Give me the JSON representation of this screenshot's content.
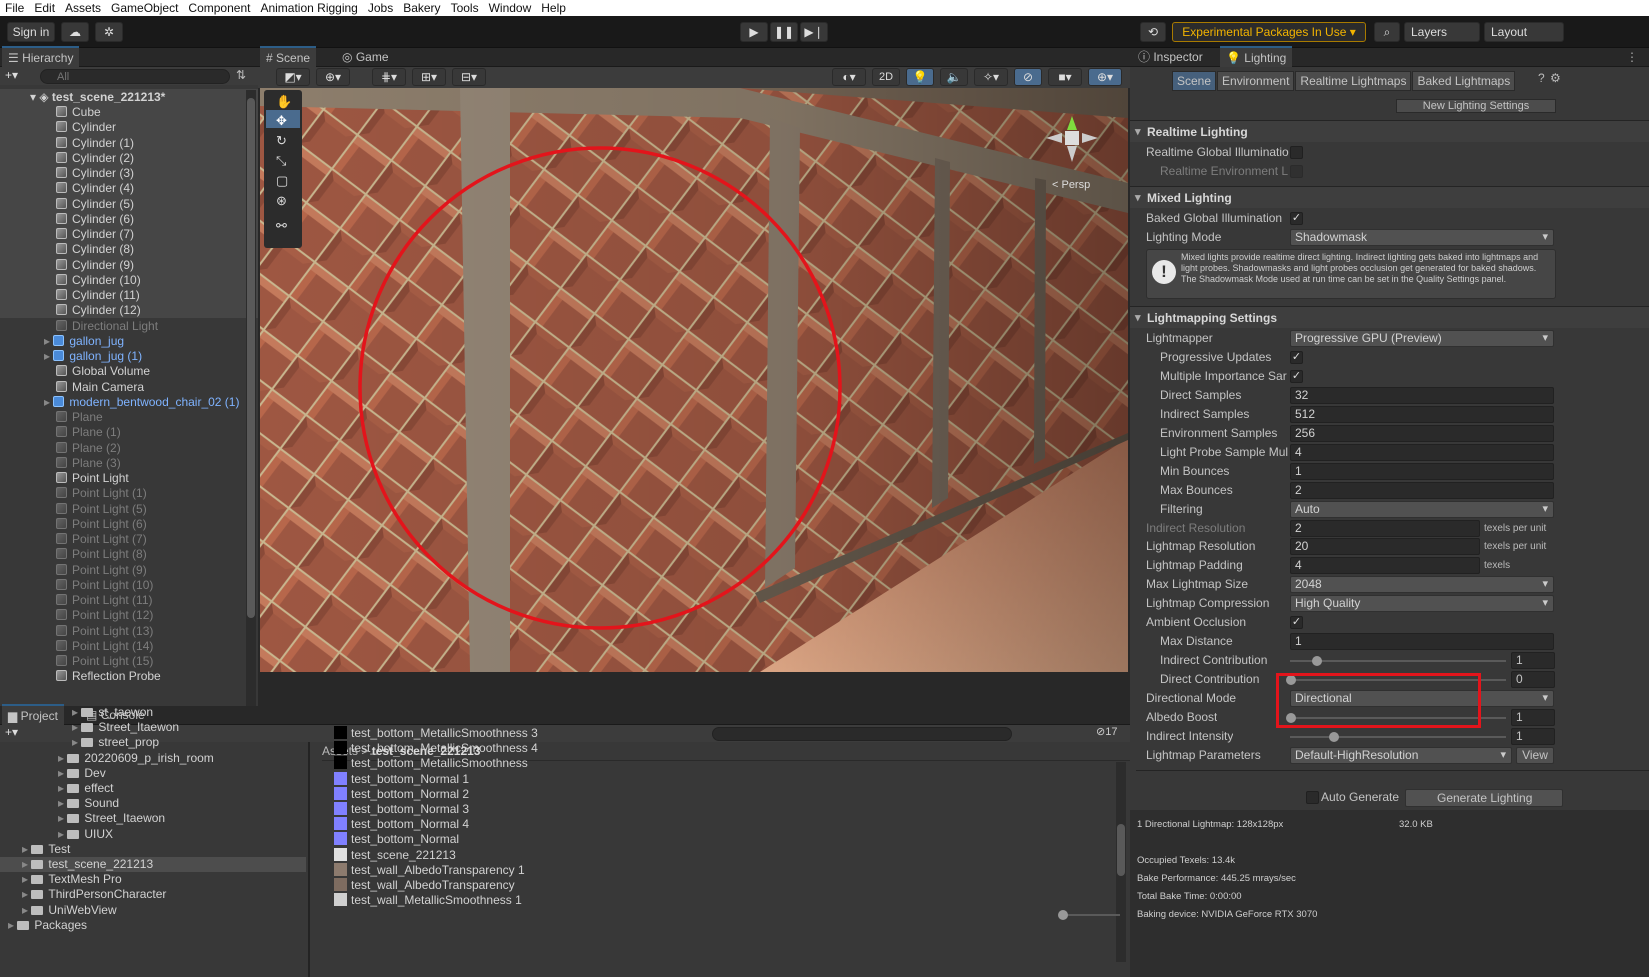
{
  "menu": [
    "File",
    "Edit",
    "Assets",
    "GameObject",
    "Component",
    "Animation Rigging",
    "Jobs",
    "Bakery",
    "Tools",
    "Window",
    "Help"
  ],
  "toolbar": {
    "sign_in": "Sign in",
    "exp_packages": "Experimental Packages In Use ▾",
    "layers": "Layers",
    "layout": "Layout"
  },
  "hierarchy": {
    "tab": "Hierarchy",
    "search_placeholder": "All",
    "scene": "test_scene_221213*",
    "items": [
      {
        "label": "Cube",
        "state": "sel"
      },
      {
        "label": "Cylinder",
        "state": "sel"
      },
      {
        "label": "Cylinder (1)",
        "state": "sel"
      },
      {
        "label": "Cylinder (2)",
        "state": "sel"
      },
      {
        "label": "Cylinder (3)",
        "state": "sel"
      },
      {
        "label": "Cylinder (4)",
        "state": "sel"
      },
      {
        "label": "Cylinder (5)",
        "state": "sel"
      },
      {
        "label": "Cylinder (6)",
        "state": "sel"
      },
      {
        "label": "Cylinder (7)",
        "state": "sel"
      },
      {
        "label": "Cylinder (8)",
        "state": "sel"
      },
      {
        "label": "Cylinder (9)",
        "state": "sel"
      },
      {
        "label": "Cylinder (10)",
        "state": "sel"
      },
      {
        "label": "Cylinder (11)",
        "state": "sel"
      },
      {
        "label": "Cylinder (12)",
        "state": "sel"
      },
      {
        "label": "Directional Light",
        "state": "dis"
      },
      {
        "label": "gallon_jug",
        "state": "pref"
      },
      {
        "label": "gallon_jug (1)",
        "state": "pref"
      },
      {
        "label": "Global Volume",
        "state": "norm"
      },
      {
        "label": "Main Camera",
        "state": "norm"
      },
      {
        "label": "modern_bentwood_chair_02 (1)",
        "state": "pref"
      },
      {
        "label": "Plane",
        "state": "dis"
      },
      {
        "label": "Plane (1)",
        "state": "dis"
      },
      {
        "label": "Plane (2)",
        "state": "dis"
      },
      {
        "label": "Plane (3)",
        "state": "dis"
      },
      {
        "label": "Point Light",
        "state": "norm"
      },
      {
        "label": "Point Light (1)",
        "state": "dis"
      },
      {
        "label": "Point Light (5)",
        "state": "dis"
      },
      {
        "label": "Point Light (6)",
        "state": "dis"
      },
      {
        "label": "Point Light (7)",
        "state": "dis"
      },
      {
        "label": "Point Light (8)",
        "state": "dis"
      },
      {
        "label": "Point Light (9)",
        "state": "dis"
      },
      {
        "label": "Point Light (10)",
        "state": "dis"
      },
      {
        "label": "Point Light (11)",
        "state": "dis"
      },
      {
        "label": "Point Light (12)",
        "state": "dis"
      },
      {
        "label": "Point Light (13)",
        "state": "dis"
      },
      {
        "label": "Point Light (14)",
        "state": "dis"
      },
      {
        "label": "Point Light (15)",
        "state": "dis"
      },
      {
        "label": "Reflection Probe",
        "state": "norm"
      }
    ]
  },
  "scene": {
    "tab_scene": "Scene",
    "tab_game": "Game",
    "mode_2d": "2D",
    "persp": "< Persp"
  },
  "inspector": {
    "tab_inspector": "Inspector",
    "tab_lighting": "Lighting",
    "subtabs": [
      "Scene",
      "Environment",
      "Realtime Lightmaps",
      "Baked Lightmaps"
    ],
    "new_settings": "New Lighting Settings",
    "realtime_section": "Realtime Lighting",
    "realtime_gi": "Realtime Global Illuminatio",
    "realtime_env": "Realtime Environment L",
    "mixed_section": "Mixed Lighting",
    "baked_gi": "Baked Global Illumination",
    "lighting_mode": "Lighting Mode",
    "lighting_mode_val": "Shadowmask",
    "info": "Mixed lights provide realtime direct lighting. Indirect lighting gets baked into lightmaps and light probes. Shadowmasks and light probes occlusion get generated for baked shadows. The Shadowmask Mode used at run time can be set in the Quality Settings panel.",
    "lm_section": "Lightmapping Settings",
    "rows": [
      {
        "label": "Lightmapper",
        "value": "Progressive GPU (Preview)",
        "kind": "drop",
        "indent": 0
      },
      {
        "label": "Progressive Updates",
        "value": "✓",
        "kind": "check",
        "indent": 1
      },
      {
        "label": "Multiple Importance Sar",
        "value": "✓",
        "kind": "check",
        "indent": 1
      },
      {
        "label": "Direct Samples",
        "value": "32",
        "kind": "field",
        "indent": 1
      },
      {
        "label": "Indirect Samples",
        "value": "512",
        "kind": "field",
        "indent": 1
      },
      {
        "label": "Environment Samples",
        "value": "256",
        "kind": "field",
        "indent": 1
      },
      {
        "label": "Light Probe Sample Mul",
        "value": "4",
        "kind": "field",
        "indent": 1
      },
      {
        "label": "Min Bounces",
        "value": "1",
        "kind": "field",
        "indent": 1
      },
      {
        "label": "Max Bounces",
        "value": "2",
        "kind": "field",
        "indent": 1
      },
      {
        "label": "Filtering",
        "value": "Auto",
        "kind": "drop",
        "indent": 1
      },
      {
        "label": "Indirect Resolution",
        "value": "2",
        "kind": "unit",
        "unit": "texels per unit",
        "indent": 0,
        "dim": true
      },
      {
        "label": "Lightmap Resolution",
        "value": "20",
        "kind": "unit",
        "unit": "texels per unit",
        "indent": 0
      },
      {
        "label": "Lightmap Padding",
        "value": "4",
        "kind": "unit",
        "unit": "texels",
        "indent": 0
      },
      {
        "label": "Max Lightmap Size",
        "value": "2048",
        "kind": "drop",
        "indent": 0
      },
      {
        "label": "Lightmap Compression",
        "value": "High Quality",
        "kind": "drop",
        "indent": 0
      },
      {
        "label": "Ambient Occlusion",
        "value": "✓",
        "kind": "check",
        "indent": 0
      },
      {
        "label": "Max Distance",
        "value": "1",
        "kind": "field",
        "indent": 1
      },
      {
        "label": "Indirect Contribution",
        "value": "1",
        "kind": "slider",
        "pos": 0.12,
        "indent": 1
      },
      {
        "label": "Direct Contribution",
        "value": "0",
        "kind": "slider",
        "pos": 0.0,
        "indent": 1
      },
      {
        "label": "Directional Mode",
        "value": "Directional",
        "kind": "drop",
        "indent": 0
      },
      {
        "label": "Albedo Boost",
        "value": "1",
        "kind": "slider",
        "pos": 0.0,
        "indent": 0
      },
      {
        "label": "Indirect Intensity",
        "value": "1",
        "kind": "slider",
        "pos": 0.2,
        "indent": 0
      },
      {
        "label": "Lightmap Parameters",
        "value": "Default-HighResolution",
        "kind": "drop2",
        "indent": 0
      }
    ],
    "view_btn": "View",
    "auto_generate": "Auto Generate",
    "generate": "Generate Lighting",
    "stats": {
      "lightmap": "1 Directional Lightmap: 128x128px",
      "size": "32.0 KB",
      "texels": "Occupied Texels: 13.4k",
      "perf": "Bake Performance: 445.25 mrays/sec",
      "time": "Total Bake Time: 0:00:00",
      "device": "Baking device: NVIDIA GeForce RTX 3070"
    }
  },
  "project": {
    "tab_project": "Project",
    "tab_console": "Console",
    "breadcrumb_root": "Assets",
    "breadcrumb_leaf": "test_scene_221213",
    "count": "17",
    "tree": [
      {
        "label": "st_taewon",
        "indent": 4
      },
      {
        "label": "Street_Itaewon",
        "indent": 4
      },
      {
        "label": "street_prop",
        "indent": 4
      },
      {
        "label": "20220609_p_irish_room",
        "indent": 3
      },
      {
        "label": "Dev",
        "indent": 3
      },
      {
        "label": "effect",
        "indent": 3
      },
      {
        "label": "Sound",
        "indent": 3
      },
      {
        "label": "Street_Itaewon",
        "indent": 3
      },
      {
        "label": "UIUX",
        "indent": 3
      },
      {
        "label": "Test",
        "indent": 1
      },
      {
        "label": "test_scene_221213",
        "indent": 1,
        "sel": true
      },
      {
        "label": "TextMesh Pro",
        "indent": 1
      },
      {
        "label": "ThirdPersonCharacter",
        "indent": 1
      },
      {
        "label": "UniWebView",
        "indent": 1
      },
      {
        "label": "Packages",
        "indent": 0
      }
    ],
    "assets": [
      {
        "label": "test_bottom_MetallicSmoothness 3",
        "color": "#000000"
      },
      {
        "label": "test_bottom_MetallicSmoothness 4",
        "color": "#000000"
      },
      {
        "label": "test_bottom_MetallicSmoothness",
        "color": "#000000"
      },
      {
        "label": "test_bottom_Normal 1",
        "color": "#8080ff"
      },
      {
        "label": "test_bottom_Normal 2",
        "color": "#8080ff"
      },
      {
        "label": "test_bottom_Normal 3",
        "color": "#8080ff"
      },
      {
        "label": "test_bottom_Normal 4",
        "color": "#8080ff"
      },
      {
        "label": "test_bottom_Normal",
        "color": "#8080ff"
      },
      {
        "label": "test_scene_221213",
        "color": "#e0e0e0"
      },
      {
        "label": "test_wall_AlbedoTransparency 1",
        "color": "#8d7b6e"
      },
      {
        "label": "test_wall_AlbedoTransparency",
        "color": "#7e6c60"
      },
      {
        "label": "test_wall_MetallicSmoothness 1",
        "color": "#cfcfcf"
      }
    ]
  }
}
